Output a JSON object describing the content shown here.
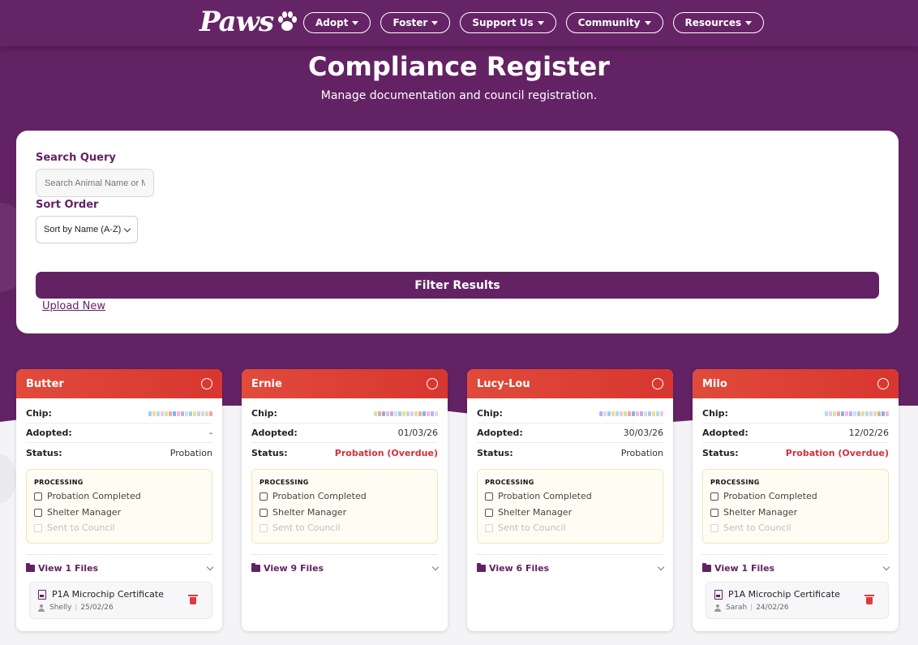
{
  "nav": {
    "logo": "Paws",
    "menu": [
      {
        "label": "Adopt"
      },
      {
        "label": "Foster"
      },
      {
        "label": "Support Us"
      },
      {
        "label": "Community"
      },
      {
        "label": "Resources"
      }
    ]
  },
  "header": {
    "title": "Compliance Register",
    "subtitle": "Manage documentation and council registration."
  },
  "filters": {
    "search_label": "Search Query",
    "search_placeholder": "Search Animal Name or Mi",
    "sort_label": "Sort Order",
    "sort_value": "Sort by Name (A-Z)",
    "filter_button": "Filter Results",
    "upload_link": "Upload New"
  },
  "labels": {
    "chip": "Chip:",
    "adopted": "Adopted:",
    "status": "Status:",
    "processing": "PROCESSING",
    "probation_completed": "Probation Completed",
    "shelter_manager": "Shelter Manager",
    "sent_to_council": "Sent to Council"
  },
  "colors": {
    "brand": "#632263",
    "header_red": "#d8362f",
    "overdue": "#d32f3b"
  },
  "cards": [
    {
      "name": "Butter",
      "adopted": "-",
      "status": "Probation",
      "status_overdue": false,
      "files_label": "View 1 Files",
      "file": {
        "name": "P1A Microchip Certificate",
        "user": "Shelly",
        "date": "25/02/26"
      }
    },
    {
      "name": "Ernie",
      "adopted": "01/03/26",
      "status": "Probation (Overdue)",
      "status_overdue": true,
      "files_label": "View 9 Files",
      "file": null
    },
    {
      "name": "Lucy-Lou",
      "adopted": "30/03/26",
      "status": "Probation",
      "status_overdue": false,
      "files_label": "View 6 Files",
      "file": null
    },
    {
      "name": "Milo",
      "adopted": "12/02/26",
      "status": "Probation (Overdue)",
      "status_overdue": true,
      "files_label": "View 1 Files",
      "file": {
        "name": "P1A Microchip Certificate",
        "user": "Sarah",
        "date": "24/02/26"
      }
    }
  ]
}
